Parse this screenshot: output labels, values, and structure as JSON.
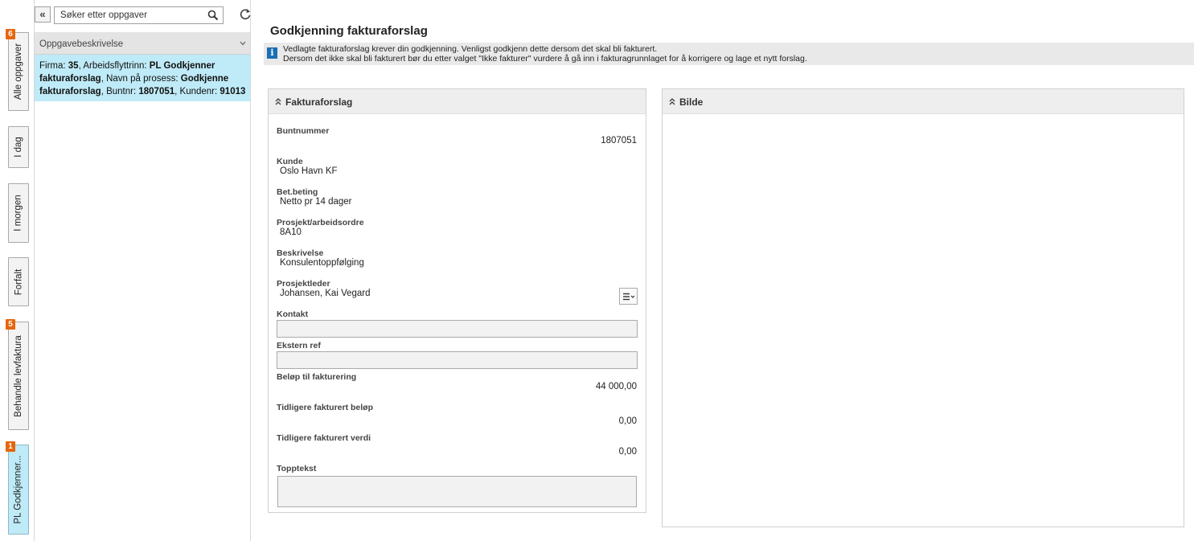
{
  "rail": {
    "tabs": [
      {
        "label": "Alle oppgaver",
        "badge": "6"
      },
      {
        "label": "I dag",
        "badge": null
      },
      {
        "label": "I morgen",
        "badge": null
      },
      {
        "label": "Forfalt",
        "badge": null
      },
      {
        "label": "Behandle levfaktura",
        "badge": "5"
      },
      {
        "label": "PL Godkjenner...",
        "badge": "1"
      }
    ]
  },
  "taskpanel": {
    "search_placeholder": "Søker etter oppgaver",
    "list_header": "Oppgavebeskrivelse",
    "task": {
      "firma_label": "Firma: ",
      "firma": "35",
      "trinn_label": ", Arbeidsflyttrinn: ",
      "trinn": "PL Godkjenner fakturaforslag",
      "prosess_label": ", Navn på prosess: ",
      "prosess": "Godkjenne fakturaforslag",
      "bunt_label": ", Buntnr: ",
      "bunt": "1807051",
      "kunde_label": ", Kundenr: ",
      "kunde": "91013"
    }
  },
  "main": {
    "title": "Godkjenning fakturaforslag",
    "info_line1": "Vedlagte fakturaforslag krever din godkjenning. Venligst godkjenn dette dersom det skal bli fakturert.",
    "info_line2": "Dersom det ikke skal bli fakturert bør du etter valget \"Ikke fakturer\" vurdere å gå inn i fakturagrunnlaget for å korrigere og lage et nytt forslag.",
    "panel1_title": "Fakturaforslag",
    "panel2_title": "Bilde",
    "fields": {
      "buntnummer": {
        "label": "Buntnummer",
        "value": "1807051"
      },
      "kunde": {
        "label": "Kunde",
        "value": "Oslo Havn KF"
      },
      "betbeting": {
        "label": "Bet.beting",
        "value": "Netto pr 14 dager"
      },
      "prosjekt": {
        "label": "Prosjekt/arbeidsordre",
        "value": "8A10"
      },
      "beskrivelse": {
        "label": "Beskrivelse",
        "value": "Konsulentoppfølging"
      },
      "prosjektleder": {
        "label": "Prosjektleder",
        "value": "Johansen, Kai Vegard"
      },
      "kontakt": {
        "label": "Kontakt",
        "value": ""
      },
      "eksternref": {
        "label": "Ekstern ref",
        "value": ""
      },
      "belop": {
        "label": "Beløp til fakturering",
        "value": "44 000,00"
      },
      "tidl_belop": {
        "label": "Tidligere fakturert beløp",
        "value": "0,00"
      },
      "tidl_verdi": {
        "label": "Tidligere fakturert verdi",
        "value": "0,00"
      },
      "topptekst": {
        "label": "Topptekst",
        "value": ""
      }
    }
  }
}
